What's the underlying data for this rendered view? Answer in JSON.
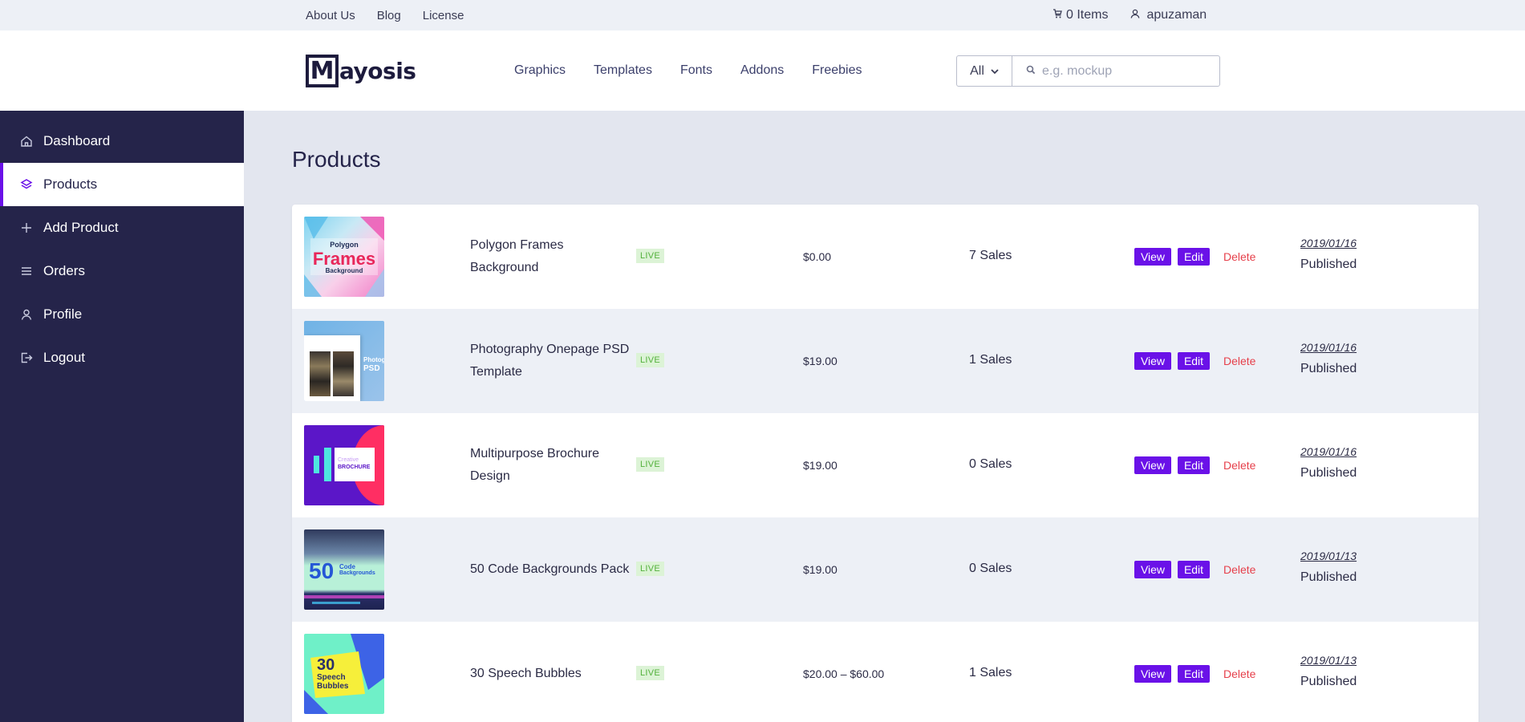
{
  "topbar": {
    "links": [
      "About Us",
      "Blog",
      "License"
    ],
    "cart": "0 Items",
    "user": "apuzaman"
  },
  "header": {
    "logo_letter": "M",
    "logo_text": "ayosis",
    "nav": [
      "Graphics",
      "Templates",
      "Fonts",
      "Addons",
      "Freebies"
    ],
    "search_category": "All",
    "search_placeholder": "e.g. mockup"
  },
  "sidebar": {
    "items": [
      {
        "label": "Dashboard",
        "icon": "home-icon"
      },
      {
        "label": "Products",
        "icon": "layers-icon"
      },
      {
        "label": "Add Product",
        "icon": "plus-icon"
      },
      {
        "label": "Orders",
        "icon": "list-icon"
      },
      {
        "label": "Profile",
        "icon": "user-icon"
      },
      {
        "label": "Logout",
        "icon": "logout-icon"
      }
    ],
    "active": "Products"
  },
  "main": {
    "title": "Products",
    "actions": {
      "view": "View",
      "edit": "Edit",
      "delete": "Delete"
    },
    "products": [
      {
        "name": "Polygon Frames Background",
        "badge": "LIVE",
        "price": "$0.00",
        "sales": "7 Sales",
        "date": "2019/01/16",
        "status": "Published",
        "thumb_text": [
          "Polygon",
          "Frames",
          "Background"
        ]
      },
      {
        "name": "Photography Onepage PSD Template",
        "badge": "LIVE",
        "price": "$19.00",
        "sales": "1 Sales",
        "date": "2019/01/16",
        "status": "Published",
        "thumb_text": [
          "Photog",
          "PSD"
        ]
      },
      {
        "name": "Multipurpose Brochure Design",
        "badge": "LIVE",
        "price": "$19.00",
        "sales": "0 Sales",
        "date": "2019/01/16",
        "status": "Published",
        "thumb_text": [
          "Creative",
          "BROCHURE"
        ]
      },
      {
        "name": "50 Code Backgrounds Pack",
        "badge": "LIVE",
        "price": "$19.00",
        "sales": "0 Sales",
        "date": "2019/01/13",
        "status": "Published",
        "thumb_text": [
          "50",
          "Code",
          "Backgrounds"
        ]
      },
      {
        "name": "30 Speech Bubbles",
        "badge": "LIVE",
        "price": "$20.00 – $60.00",
        "sales": "1 Sales",
        "date": "2019/01/13",
        "status": "Published",
        "thumb_text": [
          "30",
          "Speech",
          "Bubbles"
        ]
      }
    ]
  },
  "colors": {
    "accent": "#6a11e8",
    "sidebar_bg": "#25244a",
    "delete": "#e6404b",
    "live_bg": "#dcf3d6",
    "live_text": "#53b13c"
  }
}
